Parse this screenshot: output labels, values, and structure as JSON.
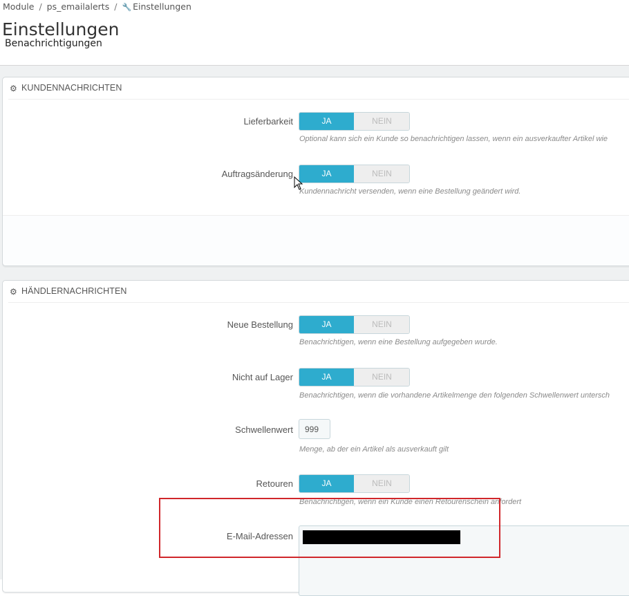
{
  "breadcrumb": {
    "items": [
      "Module",
      "ps_emailalerts"
    ],
    "current": "Einstellungen",
    "separator": "/",
    "current_icon": "wrench-icon"
  },
  "page": {
    "title": "Einstellungen",
    "subtitle": "Benachrichtigungen"
  },
  "panels": {
    "customer": {
      "title": "KUNDENNACHRICHTEN",
      "icon": "gears-icon",
      "rows": [
        {
          "label": "Lieferbarkeit",
          "yes": "JA",
          "no": "NEIN",
          "value": "JA",
          "help": "Optional kann sich ein Kunde so benachrichtigen lassen, wenn ein ausverkaufter Artikel wie"
        },
        {
          "label": "Auftragsänderung",
          "yes": "JA",
          "no": "NEIN",
          "value": "JA",
          "help": "Kundennachricht versenden, wenn eine Bestellung geändert wird."
        }
      ]
    },
    "merchant": {
      "title": "HÄNDLERNACHRICHTEN",
      "icon": "gears-icon",
      "rows": [
        {
          "label": "Neue Bestellung",
          "yes": "JA",
          "no": "NEIN",
          "value": "JA",
          "help": "Benachrichtigen, wenn eine Bestellung aufgegeben wurde."
        },
        {
          "label": "Nicht auf Lager",
          "yes": "JA",
          "no": "NEIN",
          "value": "JA",
          "help": "Benachrichtigen, wenn die vorhandene Artikelmenge den folgenden Schwellenwert untersch"
        },
        {
          "label": "Schwellenwert",
          "input_value": "999",
          "help": "Menge, ab der ein Artikel als ausverkauft gilt"
        },
        {
          "label": "Retouren",
          "yes": "JA",
          "no": "NEIN",
          "value": "JA",
          "help": "Benachrichtigen, wenn ein Kunde einen Retourenschein anfordert"
        },
        {
          "label": "E-Mail-Adressen",
          "input_value": ""
        }
      ]
    }
  },
  "colors": {
    "switch_active": "#2eacce",
    "highlight": "#d0262a",
    "page_bg": "#eff1f2"
  }
}
